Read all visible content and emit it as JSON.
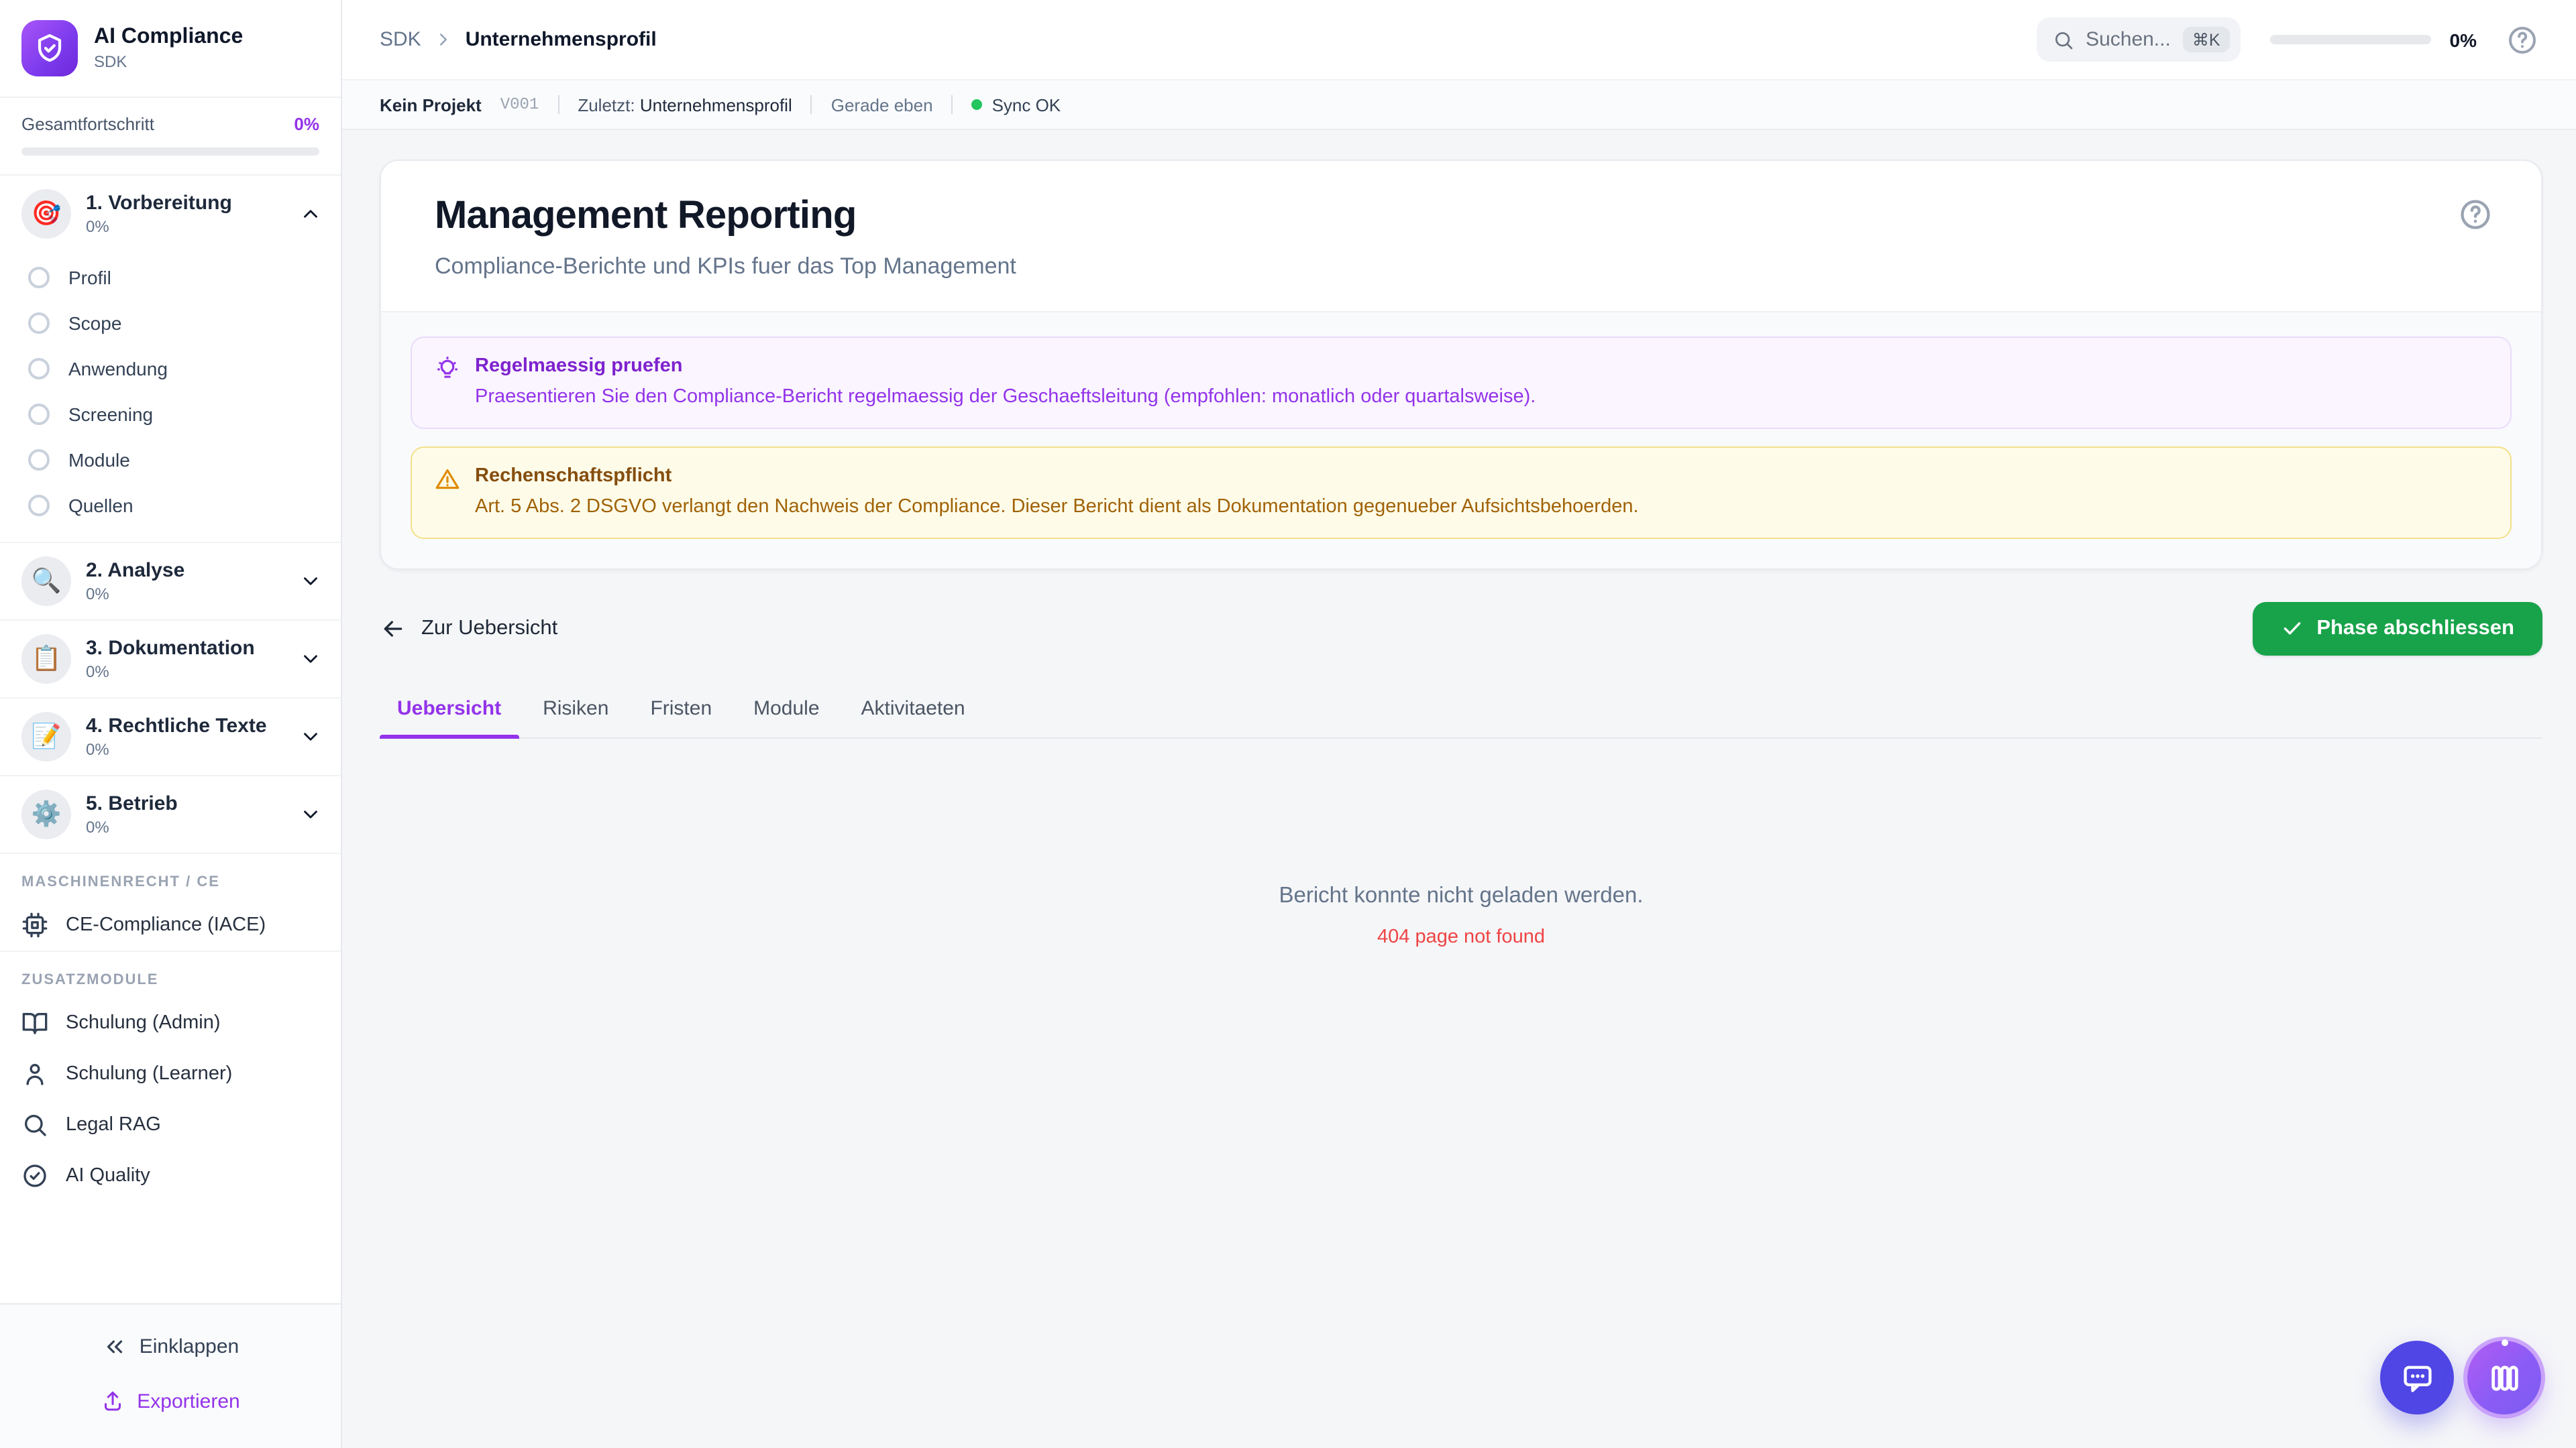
{
  "app": {
    "name": "AI Compliance",
    "subtitle": "SDK"
  },
  "sidebar": {
    "overall_label": "Gesamtfortschritt",
    "overall_value": "0%",
    "phases": [
      {
        "icon_glyph": "🎯",
        "label": "1. Vorbereitung",
        "percent": "0%",
        "expanded": true,
        "children": [
          "Profil",
          "Scope",
          "Anwendung",
          "Screening",
          "Module",
          "Quellen"
        ]
      },
      {
        "icon_glyph": "🔍",
        "label": "2. Analyse",
        "percent": "0%"
      },
      {
        "icon_glyph": "📋",
        "label": "3. Dokumentation",
        "percent": "0%"
      },
      {
        "icon_glyph": "📝",
        "label": "4. Rechtliche Texte",
        "percent": "0%"
      },
      {
        "icon_glyph": "⚙️",
        "label": "5. Betrieb",
        "percent": "0%"
      }
    ],
    "sections": [
      {
        "title": "MASCHINENRECHT / CE",
        "items": [
          {
            "icon": "cpu-icon",
            "label": "CE-Compliance (IACE)"
          }
        ]
      },
      {
        "title": "ZUSATZMODULE",
        "items": [
          {
            "icon": "book-open-icon",
            "label": "Schulung (Admin)"
          },
          {
            "icon": "user-icon",
            "label": "Schulung (Learner)"
          },
          {
            "icon": "search-icon",
            "label": "Legal RAG"
          },
          {
            "icon": "check-circle-icon",
            "label": "AI Quality"
          }
        ]
      }
    ],
    "footer": {
      "collapse_label": "Einklappen",
      "export_label": "Exportieren"
    }
  },
  "header": {
    "breadcrumb_root": "SDK",
    "breadcrumb_current": "Unternehmensprofil",
    "search_placeholder": "Suchen...",
    "search_shortcut": "⌘K",
    "progress_value": "0%"
  },
  "statusbar": {
    "project": "Kein Projekt",
    "version": "V001",
    "last_label": "Zuletzt:",
    "last_value": "Unternehmensprofil",
    "time": "Gerade eben",
    "sync": "Sync OK"
  },
  "main": {
    "title": "Management Reporting",
    "subtitle": "Compliance-Berichte und KPIs fuer das Top Management",
    "notes": [
      {
        "type": "tip",
        "title": "Regelmaessig pruefen",
        "body": "Praesentieren Sie den Compliance-Bericht regelmaessig der Geschaeftsleitung (empfohlen: monatlich oder quartalsweise)."
      },
      {
        "type": "warning",
        "title": "Rechenschaftspflicht",
        "body": "Art. 5 Abs. 2 DSGVO verlangt den Nachweis der Compliance. Dieser Bericht dient als Dokumentation gegenueber Aufsichtsbehoerden."
      }
    ],
    "back_label": "Zur Uebersicht",
    "complete_label": "Phase abschliessen",
    "tabs": [
      "Uebersicht",
      "Risiken",
      "Fristen",
      "Module",
      "Aktivitaeten"
    ],
    "active_tab": "Uebersicht",
    "empty_title": "Bericht konnte nicht geladen werden.",
    "empty_error": "404 page not found"
  },
  "colors": {
    "accent_purple": "#9333ea",
    "success_green": "#16a34a",
    "sync_green": "#22c55e",
    "error_red": "#ef4444",
    "chat_indigo": "#4f46e5"
  }
}
